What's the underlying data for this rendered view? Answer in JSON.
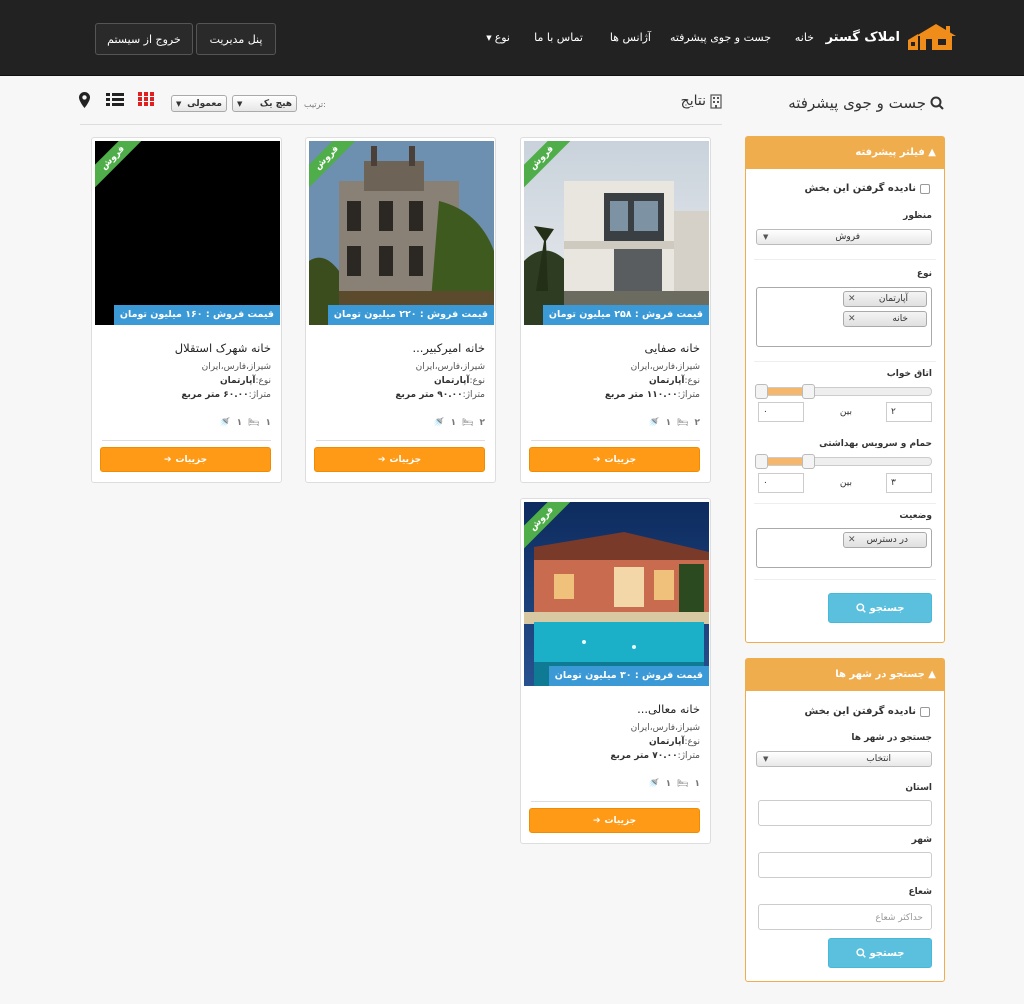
{
  "nav": {
    "brand": "املاک گستر",
    "links": [
      "خانه",
      "جست و جوی پیشرفته",
      "آژانس ها",
      "تماس با ما",
      "نوع"
    ],
    "admin_button": "پنل مدیریت",
    "logout_button": "خروج از سیستم"
  },
  "sidebar": {
    "title": "جست و جوی پیشرفته",
    "filter_panel": {
      "heading": "فیلتر پیشرفته",
      "ignore_label": "نادیده گرفتن این بخش",
      "purpose_label": "منظور",
      "purpose_value": "فروش",
      "type_label": "نوع",
      "type_tags": [
        "آپارتمان",
        "خانه"
      ],
      "bedroom_label": "اتاق خواب",
      "bedroom_min": "۰",
      "bedroom_max": "۲",
      "between_label": "بین",
      "bath_label": "حمام و سرویس بهداشتی",
      "bath_min": "۰",
      "bath_max": "۳",
      "status_label": "وضعیت",
      "status_tags": [
        "در دسترس"
      ],
      "search_button": "جستجو"
    },
    "city_panel": {
      "heading": "جستجو در شهر ها",
      "ignore_label": "نادیده گرفتن این بخش",
      "city_search_label": "جستجو در شهر ها",
      "city_select_value": "انتخاب",
      "province_label": "استان",
      "city_label": "شهر",
      "radius_label": "شعاع",
      "radius_placeholder": "حداکثر شعاع",
      "search_button": "جستجو"
    }
  },
  "results": {
    "title": "نتایج",
    "sort_label": "ترتیب:",
    "sort_value": "هیچ یک",
    "order_value": "معمولی",
    "ribbon": "فروش",
    "details_button": "جزییات",
    "cards": [
      {
        "title": "خانه صفایی",
        "price": "قیمت فروش : ۲۵۸ میلیون تومان",
        "location": "شیراز،فارس،ایران",
        "type_label": "نوع:",
        "type_value": "آپارتمان",
        "area_label": "متراژ:",
        "area_value": "۱۱۰.۰۰ متر مربع",
        "beds": "۲",
        "baths": "۱"
      },
      {
        "title": "خانه امیرکبیر...",
        "price": "قیمت فروش : ۲۲۰ میلیون تومان",
        "location": "شیراز،فارس،ایران",
        "type_label": "نوع:",
        "type_value": "آپارتمان",
        "area_label": "متراژ:",
        "area_value": "۹۰.۰۰ متر مربع",
        "beds": "۲",
        "baths": "۱"
      },
      {
        "title": "خانه شهرک استقلال",
        "price": "قیمت فروش : ۱۶۰ میلیون تومان",
        "location": "شیراز،فارس،ایران",
        "type_label": "نوع:",
        "type_value": "آپارتمان",
        "area_label": "متراژ:",
        "area_value": "۶۰.۰۰ متر مربع",
        "beds": "۱",
        "baths": "۱"
      },
      {
        "title": "خانه معالی...",
        "price": "قیمت فروش : ۳۰ میلیون تومان",
        "location": "شیراز،فارس،ایران",
        "type_label": "نوع:",
        "type_value": "آپارتمان",
        "area_label": "متراژ:",
        "area_value": "۷۰.۰۰ متر مربع",
        "beds": "۱",
        "baths": "۱"
      }
    ]
  },
  "colors": {
    "navbar": "#222222",
    "accent_orange": "#f0ad4e",
    "button_orange": "#fe9a16",
    "info_blue": "#5bc0de",
    "price_blue": "#3b99d6",
    "ribbon_green": "#4fae4a"
  }
}
